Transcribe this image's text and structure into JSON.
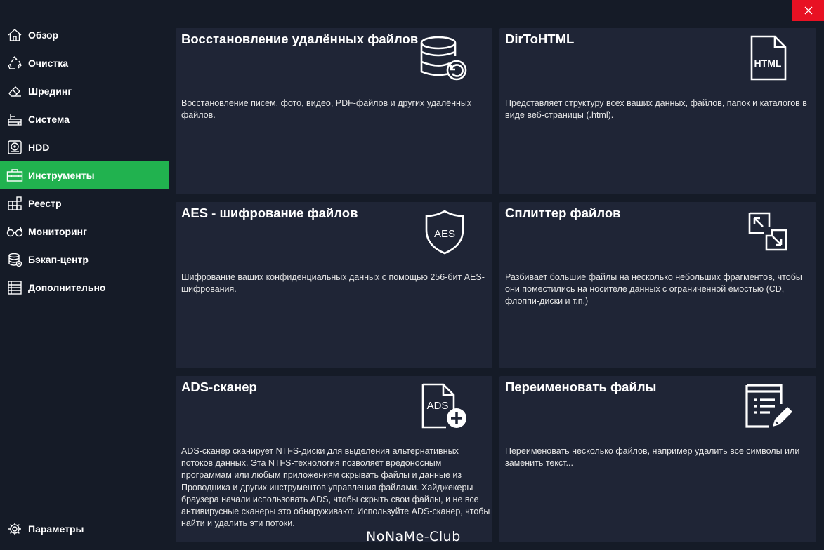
{
  "window": {
    "close_icon": "close-icon"
  },
  "sidebar": {
    "items": [
      {
        "label": "Обзор",
        "icon": "home-icon"
      },
      {
        "label": "Очистка",
        "icon": "recycle-icon"
      },
      {
        "label": "Шрединг",
        "icon": "eraser-icon"
      },
      {
        "label": "Система",
        "icon": "system-icon"
      },
      {
        "label": "HDD",
        "icon": "hdd-icon"
      },
      {
        "label": "Инструменты",
        "icon": "toolbox-icon",
        "active": true
      },
      {
        "label": "Реестр",
        "icon": "registry-icon"
      },
      {
        "label": "Мониторинг",
        "icon": "glasses-icon"
      },
      {
        "label": "Бэкап-центр",
        "icon": "database-icon"
      },
      {
        "label": "Дополнительно",
        "icon": "list-icon"
      }
    ],
    "settings": {
      "label": "Параметры",
      "icon": "gear-icon"
    }
  },
  "cards": [
    {
      "title": "Восстановление удалённых файлов",
      "description": "Восстановление писем, фото, видео, PDF-файлов и других удалённых файлов.",
      "icon": "database-restore-icon"
    },
    {
      "title": "DirToHTML",
      "description": "Представляет структуру всех ваших данных, файлов, папок и каталогов в виде веб-страницы (.html).",
      "icon": "html-file-icon",
      "icon_text": "HTML"
    },
    {
      "title": "AES - шифрование файлов",
      "description": "Шифрование ваших конфиденциальных данных с помощью 256-бит AES-шифрования.",
      "icon": "aes-shield-icon",
      "icon_text": "AES"
    },
    {
      "title": "Сплиттер файлов",
      "description": "Разбивает большие файлы на несколько небольших фрагментов, чтобы они поместились на носителе данных с ограниченной ёмостью (CD, флоппи-диски и т.п.)",
      "icon": "split-icon"
    },
    {
      "title": "ADS-сканер",
      "description": "ADS-сканер сканирует NTFS-диски для выделения альтернативных потоков данных. Эта NTFS-технология позволяет вредоносным программам или любым приложениям скрывать файлы и данные из Проводника и других инструментов управления файлами. Хайджекеры браузера начали использовать ADS, чтобы скрыть свои файлы, и не все антивирусные сканеры это обнаруживают. Используйте ADS-сканер, чтобы найти и удалить эти потоки.",
      "icon": "ads-file-add-icon",
      "icon_text": "ADS"
    },
    {
      "title": "Переименовать файлы",
      "description": "Переименовать несколько файлов, например удалить все символы или заменить текст...",
      "icon": "rename-document-icon"
    }
  ],
  "watermark": "NoNaMe-Club"
}
